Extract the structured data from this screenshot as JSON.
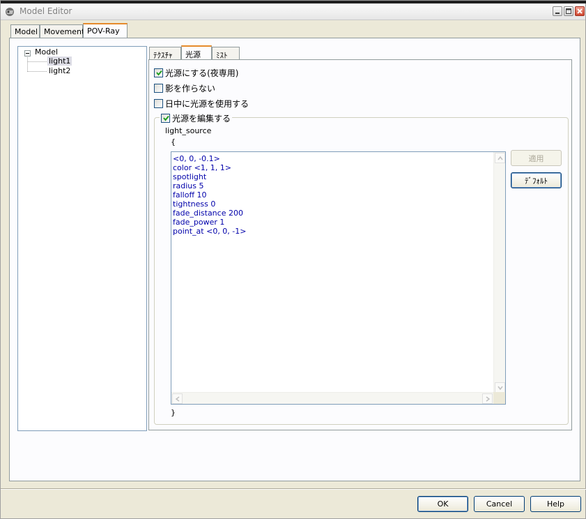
{
  "window": {
    "title": "Model Editor"
  },
  "main_tabs": [
    {
      "label": "Model"
    },
    {
      "label": "Movement"
    },
    {
      "label": "POV-Ray"
    }
  ],
  "tree": {
    "root": "Model",
    "items": [
      {
        "label": "light1",
        "selected": true
      },
      {
        "label": "light2",
        "selected": false
      }
    ]
  },
  "sub_tabs": [
    {
      "label": "ﾃｸｽﾁｬ"
    },
    {
      "label": "光源"
    },
    {
      "label": "ﾐｽﾄ"
    }
  ],
  "options": [
    {
      "label": "光源にする(夜専用)",
      "checked": true
    },
    {
      "label": "影を作らない",
      "checked": false
    },
    {
      "label": "日中に光源を使用する",
      "checked": false
    }
  ],
  "edit_group": {
    "label": "光源を編集する",
    "checked": true
  },
  "code": {
    "header": "light_source",
    "open_brace": "{",
    "close_brace": "}",
    "lines": [
      "<0, 0, -0.1>",
      "color <1, 1, 1>",
      "spotlight",
      "radius 5",
      "falloff 10",
      "tightness 0",
      "fade_distance 200",
      "fade_power 1",
      "point_at <0, 0, -1>"
    ]
  },
  "side_buttons": {
    "apply": "適用",
    "default": "ﾃﾞﾌｫﾙﾄ"
  },
  "footer_buttons": {
    "ok": "OK",
    "cancel": "Cancel",
    "help": "Help"
  },
  "colors": {
    "tab_highlight": "#e68b2c",
    "code_text": "#0000aa",
    "window_bg": "#ece9d8"
  }
}
